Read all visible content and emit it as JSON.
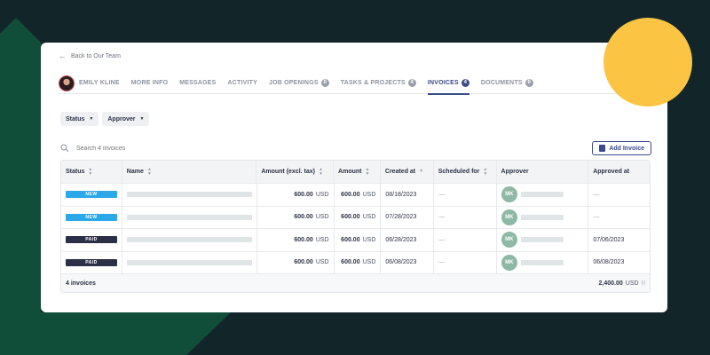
{
  "colors": {
    "background": "#12262a",
    "accent": "#3c4a8c",
    "new": "#2aa8e8",
    "paid": "#2b3046",
    "highlight": "#fbc443"
  },
  "back_link": "Back to Our Team",
  "tabs": [
    {
      "label": "EMILY KLINE"
    },
    {
      "label": "MORE INFO"
    },
    {
      "label": "MESSAGES"
    },
    {
      "label": "ACTIVITY"
    },
    {
      "label": "JOB OPENINGS",
      "count": "0"
    },
    {
      "label": "TASKS & PROJECTS",
      "count": "4"
    },
    {
      "label": "INVOICES",
      "count": "4",
      "active": true
    },
    {
      "label": "DOCUMENTS",
      "count": "0"
    }
  ],
  "filters": {
    "status": "Status",
    "approver": "Approver"
  },
  "search": {
    "placeholder": "Search 4 invoices"
  },
  "add_button": "Add Invoice",
  "table": {
    "headers": {
      "status": "Status",
      "name": "Name",
      "amount_excl": "Amount (excl. tax)",
      "amount": "Amount",
      "created": "Created at",
      "scheduled": "Scheduled for",
      "approver": "Approver",
      "approved": "Approved at"
    },
    "rows": [
      {
        "status": "NEW",
        "amount_excl": "600.00",
        "amount": "600.00",
        "currency": "USD",
        "created": "08/18/2023",
        "scheduled": "—",
        "approver": "MK",
        "approved": "—"
      },
      {
        "status": "NEW",
        "amount_excl": "600.00",
        "amount": "600.00",
        "currency": "USD",
        "created": "07/28/2023",
        "scheduled": "—",
        "approver": "MK",
        "approved": "—"
      },
      {
        "status": "PAID",
        "amount_excl": "600.00",
        "amount": "600.00",
        "currency": "USD",
        "created": "06/28/2023",
        "scheduled": "—",
        "approver": "MK",
        "approved": "07/06/2023"
      },
      {
        "status": "PAID",
        "amount_excl": "600.00",
        "amount": "600.00",
        "currency": "USD",
        "created": "06/08/2023",
        "scheduled": "—",
        "approver": "MK",
        "approved": "06/08/2023"
      }
    ],
    "footer": {
      "count": "4 invoices",
      "total": "2,400.00",
      "currency": "USD",
      "info": "(i)"
    }
  }
}
